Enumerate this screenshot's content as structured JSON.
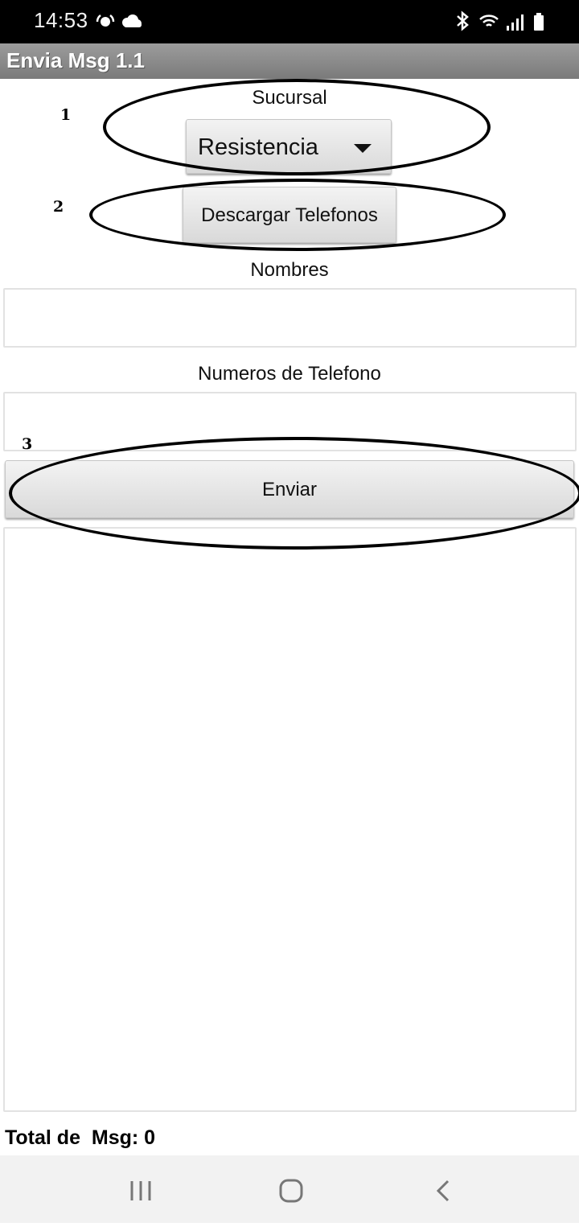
{
  "status_bar": {
    "time": "14:53",
    "left_icons": [
      "tethering-icon",
      "cloud-icon"
    ],
    "right_icons": [
      "bluetooth-icon",
      "wifi-icon",
      "signal-icon",
      "battery-icon"
    ]
  },
  "app": {
    "title": "Envia Msg 1.1"
  },
  "sucursal": {
    "label": "Sucursal",
    "selected": "Resistencia"
  },
  "descargar": {
    "label": "Descargar Telefonos"
  },
  "nombres": {
    "label": "Nombres",
    "value": ""
  },
  "telefonos": {
    "label": "Numeros de Telefono",
    "value": ""
  },
  "enviar": {
    "label": "Enviar"
  },
  "log": {
    "value": ""
  },
  "total": {
    "label": "Total de  Msg: 0"
  },
  "annotations": {
    "n1": "1",
    "n2": "2",
    "n3": "3"
  },
  "nav": {
    "items": [
      "recent-apps-icon",
      "home-icon",
      "back-icon"
    ]
  },
  "colors": {
    "status_bar": "#000000",
    "title_bar": "#8a8a8a",
    "nav_bar": "#f2f2f2"
  }
}
